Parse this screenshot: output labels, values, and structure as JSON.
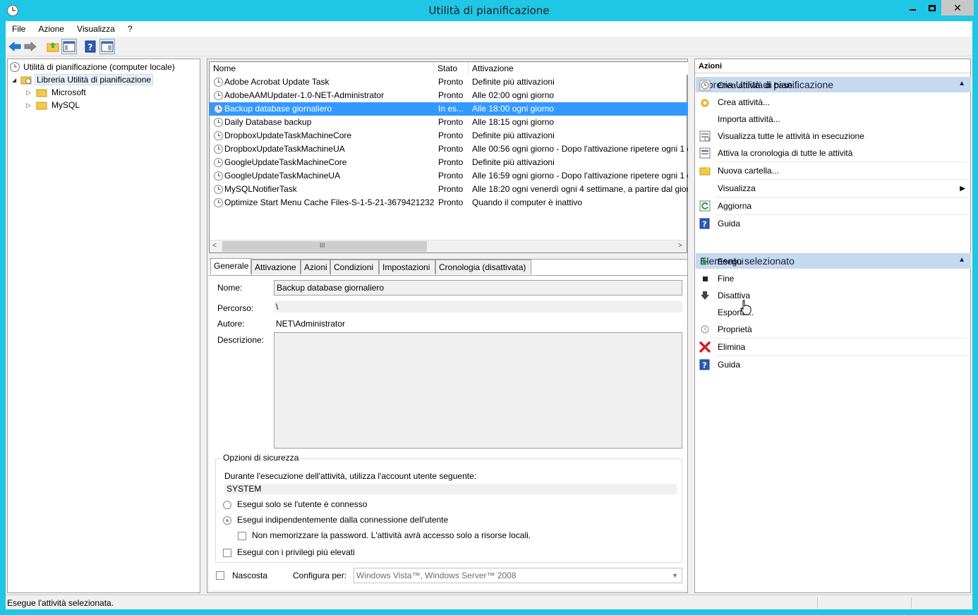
{
  "window": {
    "title": "Utilità di pianificazione"
  },
  "menu": [
    "File",
    "Azione",
    "Visualizza",
    "?"
  ],
  "tree": {
    "root": "Utilità di pianificazione (computer locale)",
    "library": "Libreria Utilità di pianificazione",
    "folders": [
      "Microsoft",
      "MySQL"
    ]
  },
  "tasks": {
    "columns": [
      "Nome",
      "Stato",
      "Attivazione"
    ],
    "rows": [
      {
        "name": "Adobe Acrobat Update Task",
        "status": "Pronto",
        "trigger": "Definite più attivazioni"
      },
      {
        "name": "AdobeAAMUpdater-1.0-NET-Administrator",
        "status": "Pronto",
        "trigger": "Alle 02:00 ogni giorno"
      },
      {
        "name": "Backup database giornaliero",
        "status": "In es...",
        "trigger": "Alle 18:00 ogni giorno"
      },
      {
        "name": "Daily Database backup",
        "status": "Pronto",
        "trigger": "Alle 18:15 ogni giorno"
      },
      {
        "name": "DropboxUpdateTaskMachineCore",
        "status": "Pronto",
        "trigger": "Definite più attivazioni"
      },
      {
        "name": "DropboxUpdateTaskMachineUA",
        "status": "Pronto",
        "trigger": "Alle 00:56 ogni giorno - Dopo l'attivazione ripetere ogni 1 o"
      },
      {
        "name": "GoogleUpdateTaskMachineCore",
        "status": "Pronto",
        "trigger": "Definite più attivazioni"
      },
      {
        "name": "GoogleUpdateTaskMachineUA",
        "status": "Pronto",
        "trigger": "Alle 16:59 ogni giorno - Dopo l'attivazione ripetere ogni 1 o"
      },
      {
        "name": "MySQLNotifierTask",
        "status": "Pronto",
        "trigger": "Alle 18:20 ogni venerdì ogni 4 settimane, a partire dal giorn"
      },
      {
        "name": "Optimize Start Menu Cache Files-S-1-5-21-3679421232...",
        "status": "Pronto",
        "trigger": "Quando il computer è inattivo"
      }
    ],
    "scroll_glyph": "III"
  },
  "detail": {
    "tabs": [
      "Generale",
      "Attivazione",
      "Azioni",
      "Condizioni",
      "Impostazioni",
      "Cronologia (disattivata)"
    ],
    "name_label": "Nome:",
    "name_value": "Backup database giornaliero",
    "path_label": "Percorso:",
    "path_value": "\\",
    "author_label": "Autore:",
    "author_value": "NET\\Administrator",
    "desc_label": "Descrizione:",
    "security": {
      "title": "Opzioni di sicurezza",
      "account_text": "Durante l'esecuzione dell'attività, utilizza l'account utente seguente:",
      "account": "SYSTEM",
      "opt1": "Esegui solo se l'utente è connesso",
      "opt2": "Esegui indipendentemente dalla connessione dell'utente",
      "nopass": "Non memorizzare la password. L'attività avrà accesso solo a risorse locali.",
      "highest": "Esegui con i privilegi più elevati"
    },
    "hidden_label": "Nascosta",
    "configure_label": "Configura per:",
    "configure_value": "Windows Vista™, Windows Server™ 2008"
  },
  "actions": {
    "header": "Azioni",
    "section1": "Libreria Utilità di pianificazione",
    "items1": [
      "Crea attività di base...",
      "Crea attività...",
      "Importa attività...",
      "Visualizza tutte le attività in esecuzione",
      "Attiva la cronologia di tutte le attività",
      "Nuova cartella...",
      "Visualizza",
      "Aggiorna",
      "Guida"
    ],
    "section2": "Elemento selezionato",
    "items2": [
      "Esegui",
      "Fine",
      "Disattiva",
      "Esporta...",
      "Proprietà",
      "Elimina",
      "Guida"
    ]
  },
  "status": {
    "text": "Esegue l'attività selezionata."
  }
}
